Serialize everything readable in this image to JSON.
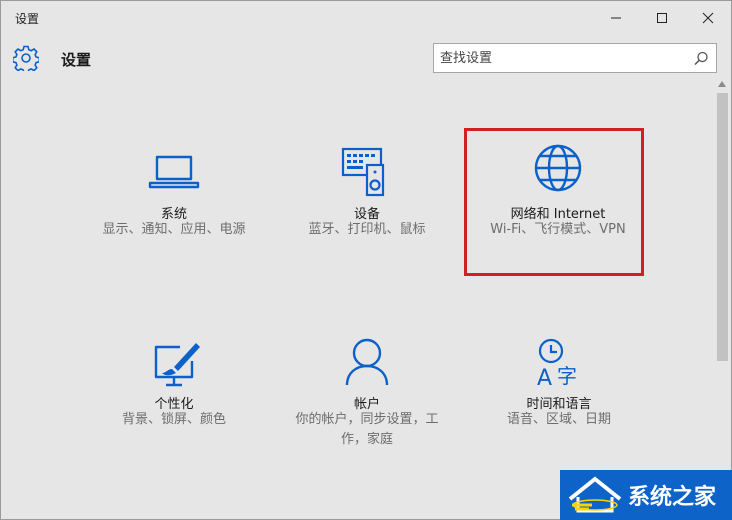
{
  "window": {
    "title": "设置"
  },
  "header": {
    "title": "设置"
  },
  "search": {
    "placeholder": "查找设置"
  },
  "tiles": [
    {
      "name": "系统",
      "desc": "显示、通知、应用、电源",
      "icon": "laptop-icon"
    },
    {
      "name": "设备",
      "desc": "蓝牙、打印机、鼠标",
      "icon": "keyboard-speaker-icon"
    },
    {
      "name": "网络和 Internet",
      "desc": "Wi-Fi、飞行模式、VPN",
      "icon": "globe-icon"
    },
    {
      "name": "个性化",
      "desc": "背景、锁屏、颜色",
      "icon": "paintbrush-screen-icon"
    },
    {
      "name": "帐户",
      "desc": "你的帐户，同步设置，工作，家庭",
      "icon": "person-icon"
    },
    {
      "name": "时间和语言",
      "desc": "语音、区域、日期",
      "icon": "time-language-icon"
    }
  ],
  "watermark": {
    "text": "系统之家"
  },
  "colors": {
    "accent": "#0e63c9",
    "icon": "#0b61c9",
    "highlight": "#d21f1f",
    "background": "#e6e6e6"
  }
}
